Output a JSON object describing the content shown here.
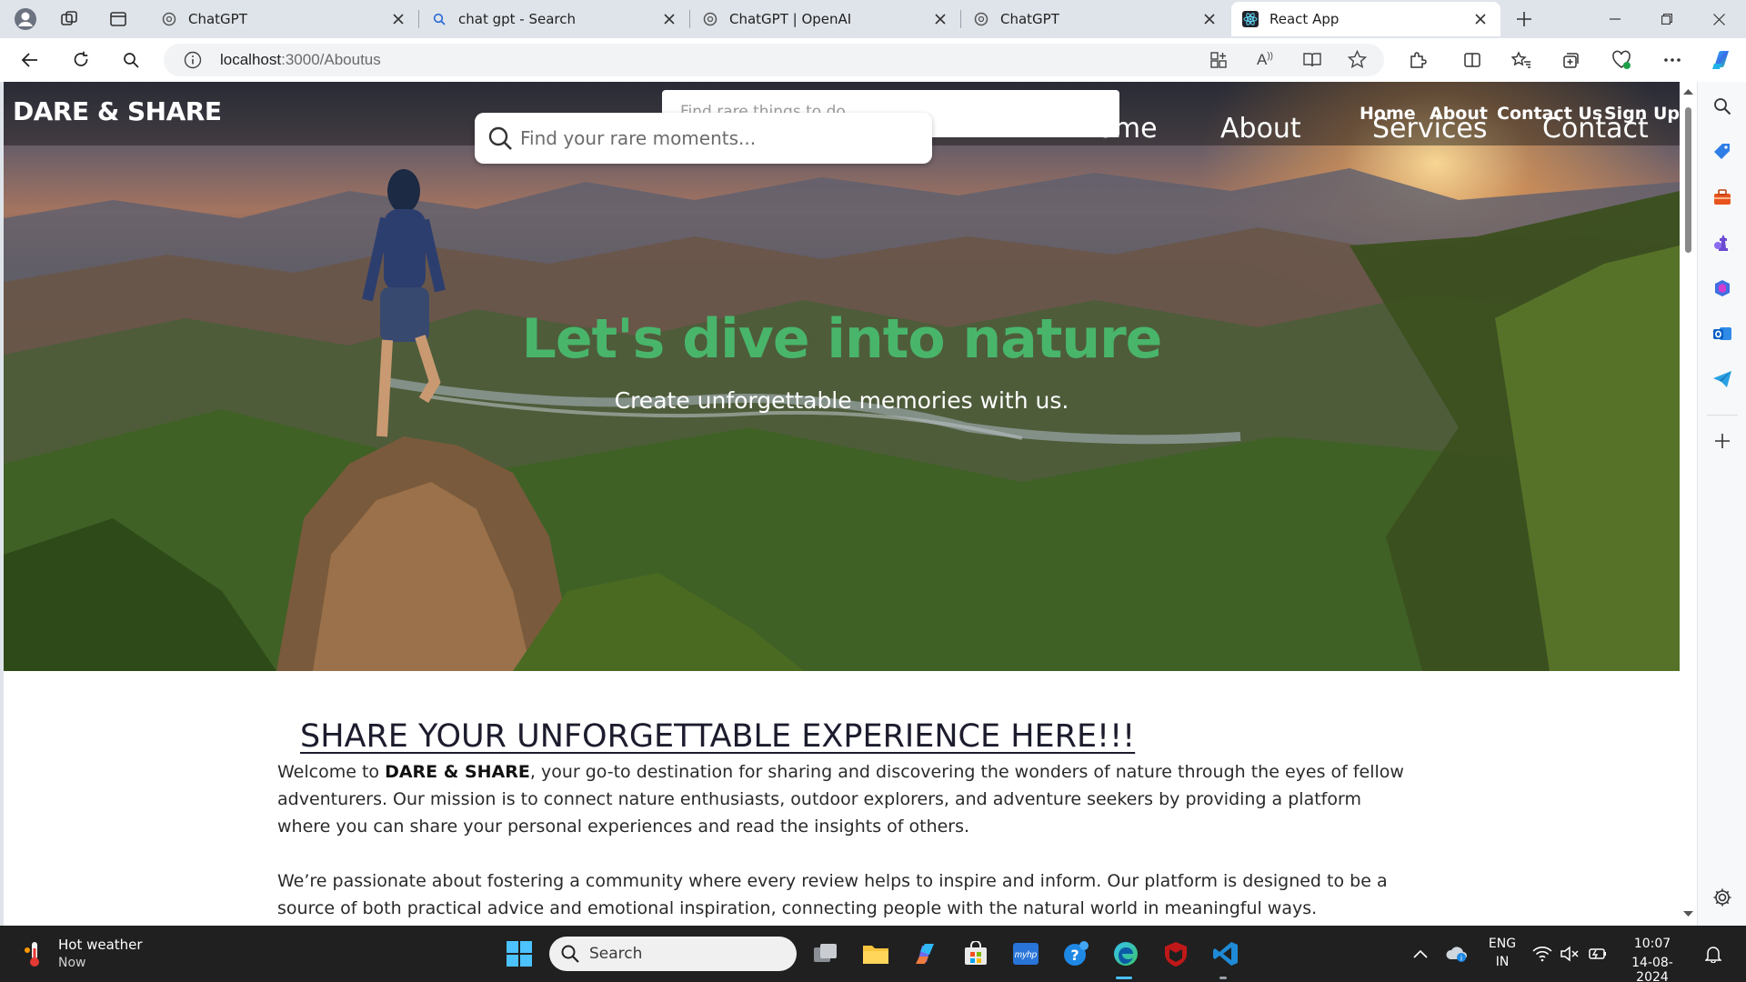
{
  "browser": {
    "tabs": [
      {
        "title": "ChatGPT",
        "favicon": "openai-icon"
      },
      {
        "title": "chat gpt - Search",
        "favicon": "search-icon"
      },
      {
        "title": "ChatGPT | OpenAI",
        "favicon": "openai-icon"
      },
      {
        "title": "ChatGPT",
        "favicon": "openai-icon"
      },
      {
        "title": "React App",
        "favicon": "react-icon",
        "active": true
      }
    ],
    "address": {
      "host": "localhost",
      "path": ":3000/Aboutus"
    }
  },
  "site": {
    "brand": "DARE & SHARE",
    "ghost_search_placeholder": "Find rare things to do",
    "search_placeholder": "Find your rare moments...",
    "nav_large": [
      "Home",
      "About",
      "Services",
      "Contact"
    ],
    "nav_small": [
      "Home",
      "About",
      "Contact Us",
      "Sign Up"
    ],
    "hero": {
      "title": "Let's dive into nature",
      "subtitle": "Create unforgettable memories with us."
    },
    "content": {
      "heading": "SHARE YOUR UNFORGETTABLE EXPERIENCE HERE!!!",
      "p1_pre": "Welcome to ",
      "p1_bold": "DARE & SHARE",
      "p1_post": ", your go-to destination for sharing and discovering the wonders of nature through the eyes of fellow adventurers. Our mission is to connect nature enthusiasts, outdoor explorers, and adventure seekers by providing a platform where you can share your personal experiences and read the insights of others.",
      "p2": "We’re passionate about fostering a community where every review helps to inspire and inform. Our platform is designed to be a source of both practical advice and emotional inspiration, connecting people with the natural world in meaningful ways."
    }
  },
  "taskbar": {
    "weather_title": "Hot weather",
    "weather_sub": "Now",
    "search_label": "Search",
    "lang_top": "ENG",
    "lang_bottom": "IN",
    "time": "10:07",
    "date": "14-08-2024"
  },
  "colors": {
    "hero_title": "#49b56b",
    "taskbar_bg": "#202020",
    "tabstrip_bg": "#dfe4ea"
  }
}
